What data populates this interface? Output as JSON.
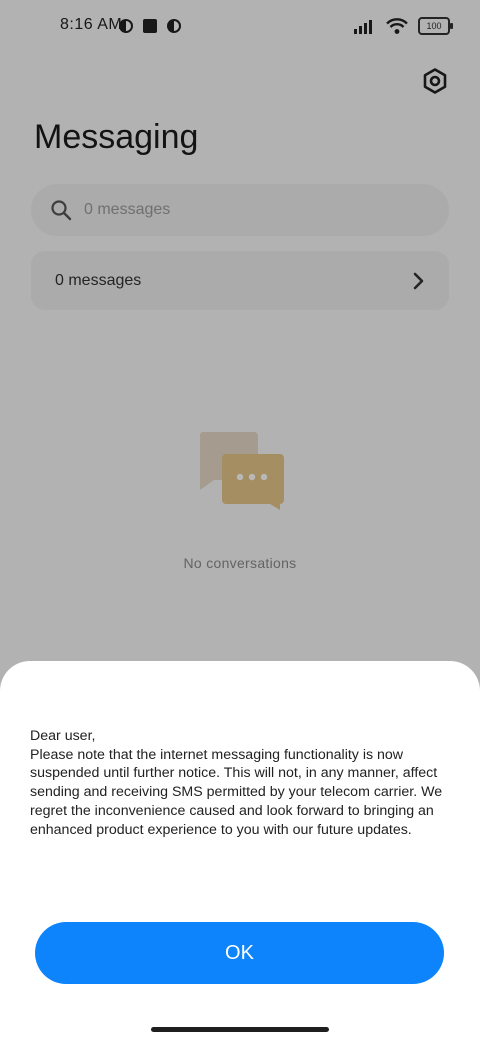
{
  "status_bar": {
    "time": "8:16 AM",
    "battery": "100"
  },
  "header": {
    "title": "Messaging"
  },
  "search": {
    "placeholder": "0 messages"
  },
  "messages_row": {
    "label": "0 messages"
  },
  "empty_state": {
    "label": "No conversations"
  },
  "dialog": {
    "greeting": "Dear user,",
    "body": "Please note that the internet messaging functionality is now suspended until further notice. This will not, in any manner, affect sending and receiving SMS permitted by your telecom carrier. We regret the inconvenience caused and look forward to bringing an enhanced product experience to you with our future updates.",
    "ok_label": "OK"
  },
  "colors": {
    "accent": "#0d84fb",
    "overlay": "rgba(0,0,0,0.28)",
    "empty_icon_back": "#e5d9c6",
    "empty_icon_front": "#e7c58a"
  }
}
